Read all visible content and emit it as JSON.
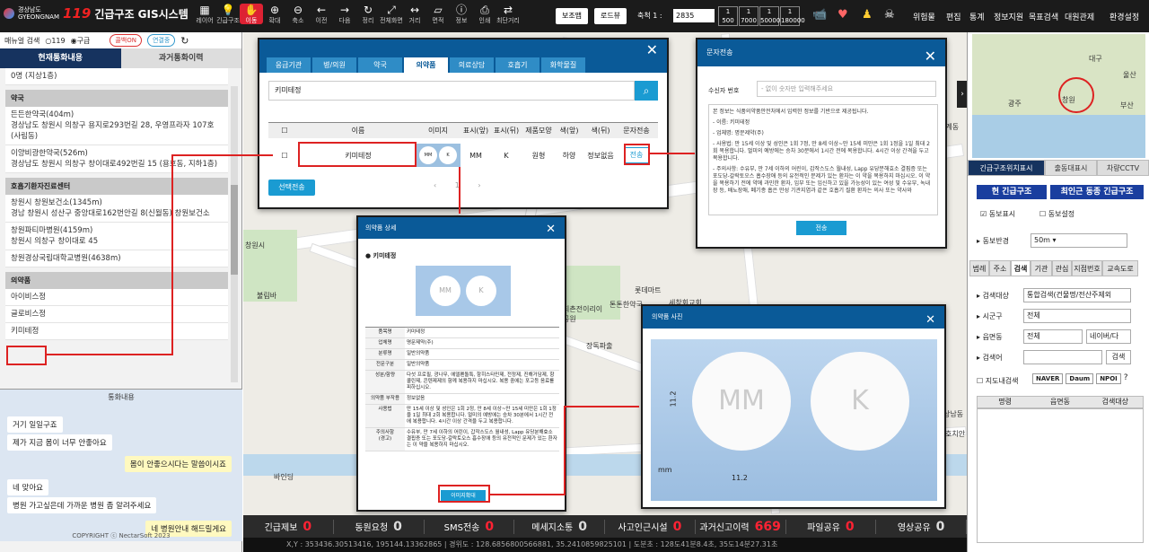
{
  "app": {
    "org": "경상남도",
    "org_en": "GYEONGNAM",
    "brand": "119",
    "title": "긴급구조 GIS시스템"
  },
  "toolbar": [
    {
      "icon": "layer-icon",
      "glyph": "▦",
      "label": "레이어"
    },
    {
      "icon": "emergency-icon",
      "glyph": "💡",
      "label": "긴급구조"
    },
    {
      "icon": "hand-icon",
      "glyph": "✋",
      "label": "이동"
    },
    {
      "icon": "zoom-in-icon",
      "glyph": "⊕",
      "label": "확대"
    },
    {
      "icon": "zoom-out-icon",
      "glyph": "⊖",
      "label": "축소"
    },
    {
      "icon": "prev-icon",
      "glyph": "←",
      "label": "이전"
    },
    {
      "icon": "next-icon",
      "glyph": "→",
      "label": "다음"
    },
    {
      "icon": "refresh-icon",
      "glyph": "↻",
      "label": "정리"
    },
    {
      "icon": "fullscreen-icon",
      "glyph": "⤢",
      "label": "전체화면"
    },
    {
      "icon": "distance-icon",
      "glyph": "↔",
      "label": "거리"
    },
    {
      "icon": "area-icon",
      "glyph": "▱",
      "label": "면적"
    },
    {
      "icon": "info-icon",
      "glyph": "ⓘ",
      "label": "정보"
    },
    {
      "icon": "print-icon",
      "glyph": "⎙",
      "label": "인쇄"
    },
    {
      "icon": "route-icon",
      "glyph": "⇄",
      "label": "최단거리"
    }
  ],
  "top_buttons": {
    "basemap": "보조맵",
    "roadview": "로드뷰"
  },
  "scale": {
    "label": "축척 1 :",
    "value": "2835",
    "presets": [
      "500",
      "7000",
      "50000",
      "180000"
    ]
  },
  "top_icons": [
    "cctv-icon",
    "heart-broken-icon",
    "person-icon",
    "skull-icon"
  ],
  "top_menu": [
    "위험물",
    "편집",
    "통계",
    "정보지원",
    "목표검색",
    "대원관제",
    "환경설정"
  ],
  "left": {
    "search_label": "매뉴얼 검색",
    "radio1": "119",
    "radio2": "구급",
    "btn_callback": "콜백ON",
    "btn_connect": "연결중",
    "tab_active": "현재통화내용",
    "tab_other": "과거통화이력",
    "sections": [
      {
        "title": "",
        "items": [
          "0명 (지상1층)"
        ]
      },
      {
        "title": "약국",
        "items": [
          "든든한약국(404m)\n경상남도 창원시 의창구 용지로293번길 28, 우영프라자 107호\n(사림동)",
          "이양비광한약국(526m)\n경상남도 창원시 의창구 창이대로492번길 15 (용호동, 지하1층)"
        ]
      },
      {
        "title": "호흡기환자진료센터",
        "items": [
          "창원시 창원보건소(1345m)\n경남 창원시 성산구 중앙대로162번안길 8(신월동) 창원보건소",
          "창원파티마병원(4159m)\n창원시 의창구 창이대로 45",
          "창원경상국립대학교병원(4638m)"
        ]
      },
      {
        "title": "의약품",
        "items": [
          "아이비스정",
          "글로비스정",
          "키미테정"
        ]
      }
    ],
    "chat_title": "통화내용",
    "chat": [
      {
        "side": "l",
        "text": "거기 일일구죠"
      },
      {
        "side": "l",
        "text": "제가 지금 몸이 너무 안좋아요"
      },
      {
        "side": "r",
        "text": "몸이 안좋으시다는 말씀이시죠"
      },
      {
        "side": "l",
        "text": "네 맞아요"
      },
      {
        "side": "l",
        "text": "병원 가고싶은데 가까운 병원 좀 알려주세요"
      },
      {
        "side": "r",
        "text": "네 병원안내 해드릴게요"
      }
    ],
    "copyright": "COPYRIGHT ⓒ NectarSoft 2023"
  },
  "drug_modal": {
    "tabs": [
      "응급기관",
      "병/의원",
      "약국",
      "의약품",
      "의료상담",
      "호흡기",
      "화학물질"
    ],
    "active_tab": "의약품",
    "search_value": "키미테정",
    "headers": [
      "이름",
      "이미지",
      "표시(앞)",
      "표시(뒤)",
      "제품모양",
      "색(앞)",
      "색(뒤)",
      "문자전송"
    ],
    "row": {
      "name": "키미테정",
      "front": "MM",
      "back": "K",
      "shape": "원형",
      "color_front": "하양",
      "color_back": "정보없음",
      "send": "전송"
    },
    "select_send": "선택전송",
    "page": "1"
  },
  "sms_modal": {
    "title": "문자전송",
    "recipient_label": "수신자 번호",
    "recipient_placeholder": "- 없이 숫자만 입력해주세요",
    "lines": [
      "본 정보는 식품의약품안전처에서 입력한 정보를 기반으로 제공됩니다.",
      "- 이름: 키미테정",
      "- 업체명: 명문제약(주)",
      "- 사용법: 만 15세 이상 및 성인은 1회 7정, 만 8세 이상~만 15세 미만은 1회 1정을 1일 최대 2회 복용합니다. 멀미의 예방에는 승차 30분에서 1시간 전에 복용합니다. 4시간 이상 간격을 두고 복용합니다.",
      "- 주의사항: 수유부, 만 7세 이하의 어린이, 갑작스도스 월내성, Lapp 유당분해효소 결핍증 또는 포도당-갈락토오스 흡수장애 등의 유전적인 문제가 있는 환자는 이 약을 복용하지 마십시오. 이 약을 복용하기 전에 약에 과민한 환자, 임부 또는 임신하고 있을 가능성이 있는 여성 및 수유부, 녹내장 등, 배뇨장애, 폐기종 흡은 만성 기관지염과 같은 호흡기 질환 환자는 의사 또는 약사와"
    ],
    "send": "전송"
  },
  "detail_modal": {
    "title": "의약품 상세",
    "drug": "키미테정",
    "rows": [
      [
        "품목명",
        "키미테정"
      ],
      [
        "업체명",
        "명문제약(주)"
      ],
      [
        "분류명",
        "일반의약품"
      ],
      [
        "전문구분",
        "일반의약품"
      ],
      [
        "성분/함량",
        "다섯 프로필, 광나무, 에델펜돌특, 항히스타민제, 전정제, 진해거담제, 항콜린제, 콘텐제제의 함께 복용하지 마십시오. 복용 중에는 포고등 음료를 피하십시오."
      ],
      [
        "의약품 부작용",
        "정보없음"
      ],
      [
        "사용법",
        "만 15세 이상 및 성인은 1회 2정, 만 8세 이상~만 15세 미만은 1회 1정을 1일 최대 2회 복용합니다. 멀미의 예방에는 승차 30분에서 1시간 전에 복용합니다. 4시간 이상 간격을 두고 복용합니다."
      ],
      [
        "주의사항\n(경고)",
        "수유부, 만 7세 이하의 어린이, 갑작스도스 월내성, Lapp 유당분해효소 결핍증 또는 포도당-갈락토오스 흡수장애 등의 유전적인 문제가 있는 환자는 이 약을 복용하지 마십시오."
      ]
    ],
    "enlarge": "이미지확대"
  },
  "image_modal": {
    "title": "의약품 사진",
    "front": "MM",
    "back": "K",
    "height": "11.2",
    "width": "11.2",
    "unit": "mm"
  },
  "map_labels": [
    "롯데마트",
    "세창회교회",
    "되촌전이리이공원",
    "톤톤한약국",
    "불림바",
    "창원시",
    "바인딩",
    "장독파출",
    "도계동",
    "상남동",
    "호치안"
  ],
  "bottom": [
    {
      "label": "긴급제보",
      "value": "0",
      "red": true
    },
    {
      "label": "동원요청",
      "value": "0",
      "red": false
    },
    {
      "label": "SMS전송",
      "value": "0",
      "red": true
    },
    {
      "label": "메세지소통",
      "value": "0",
      "red": false
    },
    {
      "label": "사고인근시설",
      "value": "0",
      "red": true
    },
    {
      "label": "과거신고이력",
      "value": "669",
      "red": true
    },
    {
      "label": "파일공유",
      "value": "0",
      "red": true
    },
    {
      "label": "영상공유",
      "value": "0",
      "red": false
    }
  ],
  "coords": "X,Y : 353436.30513416, 195144.13362865 | 경위도 : 128.6856800566881, 35.2410859825101 | 도분초 : 128도41분8.4초, 35도14분27.31초",
  "right": {
    "map_labels": [
      "대구",
      "부산",
      "광주",
      "울산",
      "창원"
    ],
    "tabs": [
      "긴급구조위치표시",
      "출동대표시",
      "차량CCTV"
    ],
    "btn_current": "현 긴급구조",
    "btn_latest": "최인근 동종 긴급구조",
    "chk_display": "동보표시",
    "chk_setting": "동보설정",
    "radius_label": "동보반경",
    "radius_value": "50m",
    "search_tabs": [
      "범례",
      "주소",
      "검색",
      "기관",
      "관심",
      "지점번호",
      "교속도로"
    ],
    "target_label": "검색대상",
    "target_value": "통합검색(건물명/전산주제외",
    "sigungu_label": "시군구",
    "sigungu_value": "전체",
    "dong_label": "읍면동",
    "dong_value": "전체",
    "dong_sub": "네이버/다",
    "keyword_label": "검색어",
    "search_btn": "검색",
    "engine_label": "지도내검색",
    "engines": [
      "NAVER",
      "Daum",
      "NPOI"
    ],
    "table_headers": [
      "명령",
      "읍면동",
      "검색대상"
    ]
  }
}
